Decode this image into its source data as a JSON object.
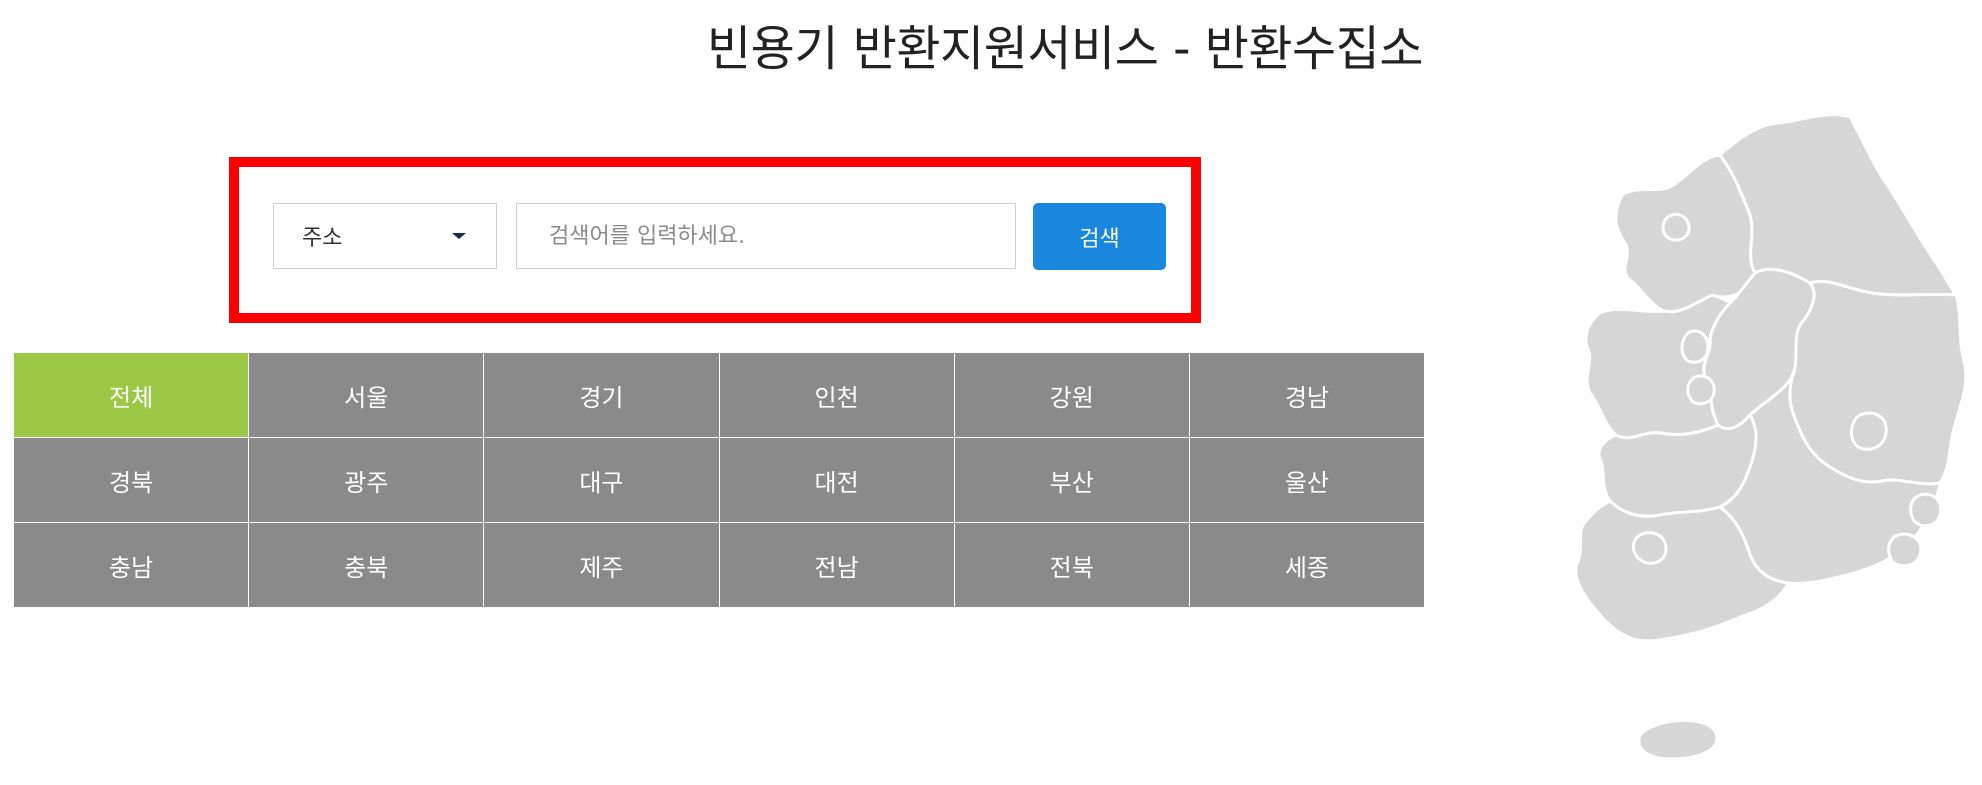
{
  "page": {
    "title": "빈용기 반환지원서비스 - 반환수집소"
  },
  "search": {
    "select_value": "주소",
    "placeholder": "검색어를 입력하세요.",
    "button_label": "검색"
  },
  "regions": {
    "active": "전체",
    "items": [
      {
        "label": "전체"
      },
      {
        "label": "서울"
      },
      {
        "label": "경기"
      },
      {
        "label": "인천"
      },
      {
        "label": "강원"
      },
      {
        "label": "경남"
      },
      {
        "label": "경북"
      },
      {
        "label": "광주"
      },
      {
        "label": "대구"
      },
      {
        "label": "대전"
      },
      {
        "label": "부산"
      },
      {
        "label": "울산"
      },
      {
        "label": "충남"
      },
      {
        "label": "충북"
      },
      {
        "label": "제주"
      },
      {
        "label": "전남"
      },
      {
        "label": "전북"
      },
      {
        "label": "세종"
      }
    ]
  },
  "colors": {
    "active_region": "#9bc946",
    "region_cell": "#8a8a8a",
    "search_button": "#1a87de",
    "highlight_frame": "#ff0000",
    "map_fill": "#d6d6d6"
  },
  "icons": {
    "select_caret": "chevron-down-icon",
    "map": "korea-map-icon"
  }
}
